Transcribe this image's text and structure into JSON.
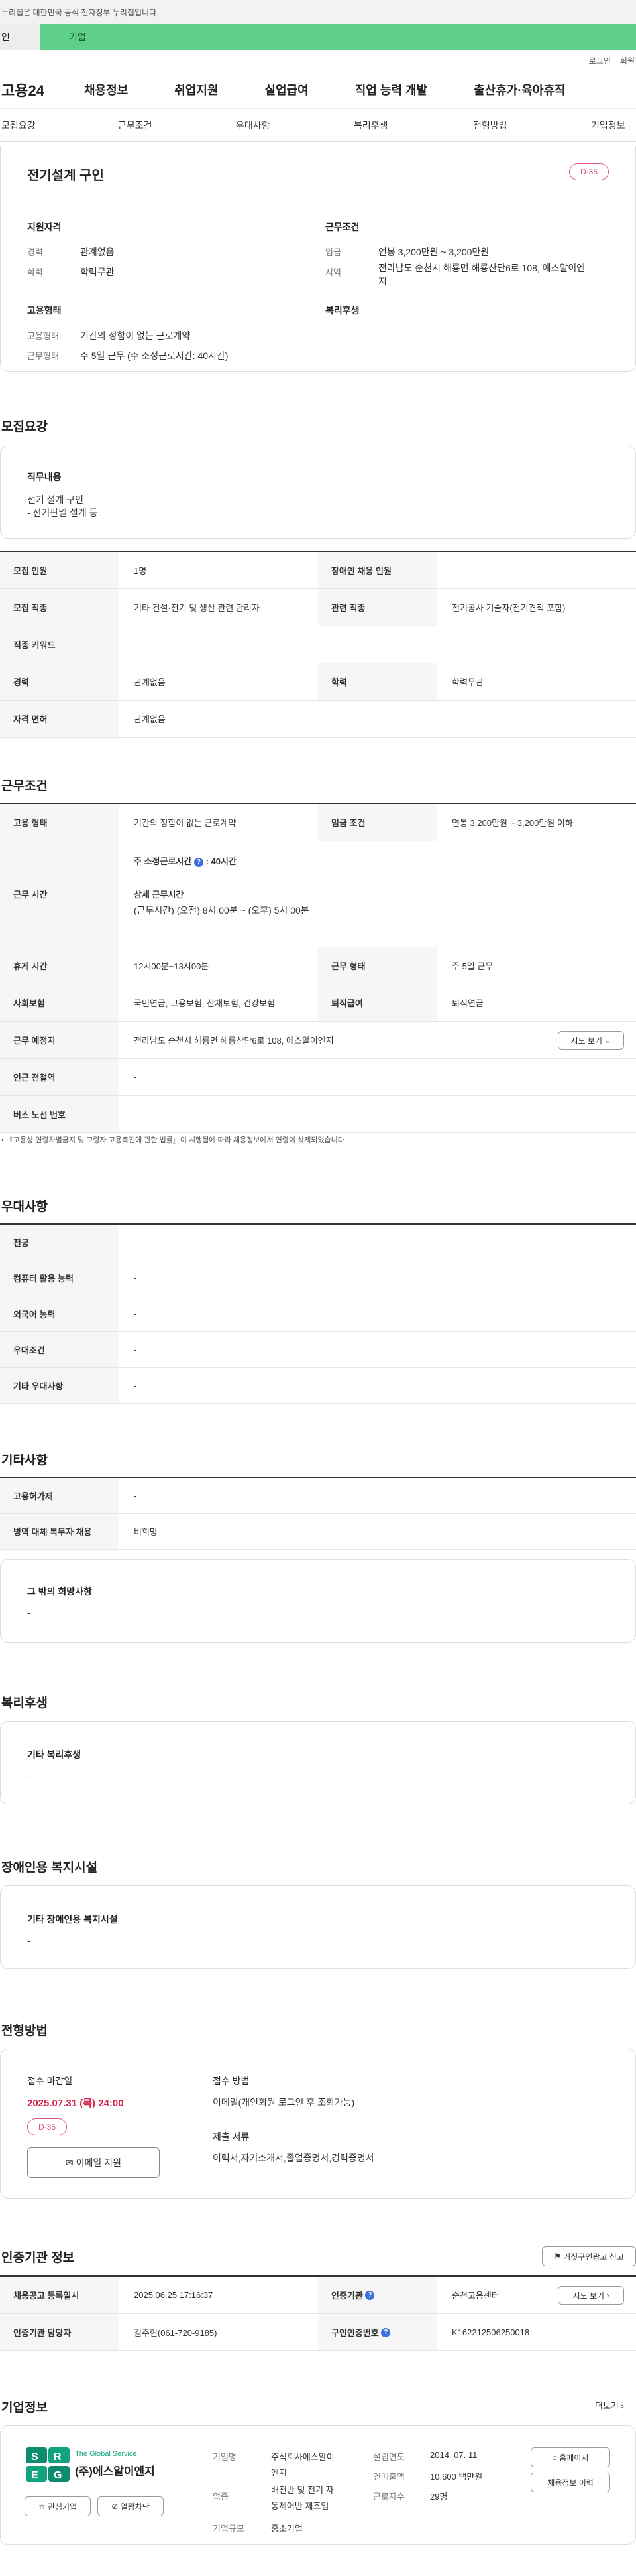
{
  "gov_banner": "이 누리집은 대한민국 공식 전자정부 누리집입니다.",
  "gov_banner_visible": "누리집은 대한민국 공식 전자정부 누리집입니다.",
  "top_tabs": [
    "개인",
    "기업"
  ],
  "top_tabs_visible": [
    "인",
    "기업"
  ],
  "util": {
    "login": "로그인",
    "join": "회원가입"
  },
  "util_visible": {
    "login": "로그인",
    "join": "회원"
  },
  "logo": "고용24",
  "gnb": [
    "채용정보",
    "취업지원",
    "실업급여",
    "직업 능력 개발",
    "출산휴가·육아휴직"
  ],
  "anchors": [
    "모집요강",
    "근무조건",
    "우대사항",
    "복리후생",
    "전형방법",
    "기업정보"
  ],
  "summary": {
    "title": "전기설계 구인",
    "dday": "D-35",
    "qual_h": "지원자격",
    "career_l": "경력",
    "career_v": "관계없음",
    "edu_l": "학력",
    "edu_v": "학력무관",
    "cond_h": "근무조건",
    "wage_l": "임금",
    "wage_v": "연봉 3,200만원 ~ 3,200만원",
    "area_l": "지역",
    "area_v1": "전라남도 순천시 해룡면 해룡산단6로 108, 에스알이엔",
    "area_v2": "지",
    "emp_h": "고용형태",
    "type_l": "고용형태",
    "type_v": "기간의 정함이 없는 근로계약",
    "form_l": "근무형태",
    "form_v": "주 5일 근무 (주 소정근로시간: 40시간)",
    "welfare_h": "복리후생"
  },
  "recruit": {
    "heading": "모집요강",
    "duty_h": "직무내용",
    "duty_1": "전기 설계 구인",
    "duty_2": "- 전기판넬 설계 등",
    "rows": [
      {
        "k1": "모집 인원",
        "v1": "1명",
        "k2": "장애인 채용 인원",
        "v2": "-"
      },
      {
        "k1": "모집 직종",
        "v1": "기타 건설·전기 및 생산 관련 관리자",
        "k2": "관련 직종",
        "v2": "전기공사 기술자(전기견적 포함)"
      },
      {
        "k1": "직종 키워드",
        "v1": "-"
      },
      {
        "k1": "경력",
        "v1": "관계없음",
        "k2": "학력",
        "v2": "학력무관"
      },
      {
        "k1": "자격 면허",
        "v1": "관계없음"
      }
    ]
  },
  "work": {
    "heading": "근무조건",
    "emp_k": "고용 형태",
    "emp_v": "기간의 정함이 없는 근로계약",
    "wage_k": "임금 조건",
    "wage_v": "연봉 3,200만원 ~ 3,200만원 이하",
    "time_k": "근무 시간",
    "time_a": "주 소정근로시간",
    "time_b": ": 40시간",
    "time_c": "상세 근무시간",
    "time_d": "(근무시간) (오전) 8시 00분 ~ (오후) 5시 00분",
    "rest_k": "휴게 시간",
    "rest_v": "12시00분~13시00분",
    "form_k": "근무 형태",
    "form_v": "주 5일 근무",
    "ins_k": "사회보험",
    "ins_v": "국민연금, 고용보험, 산재보험, 건강보험",
    "sev_k": "퇴직급여",
    "sev_v": "퇴직연금",
    "place_k": "근무 예정지",
    "place_v": "전라남도 순천시 해룡면 해룡산단6로 108, 에스알이엔지",
    "map_btn": "지도 보기",
    "sub_k": "인근 전철역",
    "sub_v": "-",
    "bus_k": "버스 노선 번호",
    "bus_v": "-",
    "note": "• 『고용상 연령차별금지 및 고령자 고용촉진에 관한 법률』이 시행됨에 따라 채용정보에서 연령이 삭제되었습니다."
  },
  "prefer": {
    "heading": "우대사항",
    "rows": [
      [
        "전공",
        "-"
      ],
      [
        "컴퓨터 활용 능력",
        "-"
      ],
      [
        "외국어 능력",
        "-"
      ],
      [
        "우대조건",
        "-"
      ],
      [
        "기타 우대사항",
        "-"
      ]
    ]
  },
  "etc": {
    "heading": "기타사항",
    "rows": [
      [
        "고용허가제",
        "-"
      ],
      [
        "병역 대체 복무자 채용",
        "비희망"
      ]
    ],
    "box_h": "그 밖의 희망사항",
    "box_v": "-"
  },
  "welfare": {
    "heading": "복리후생",
    "box_h": "기타 복리후생",
    "box_v": "-"
  },
  "disabled": {
    "heading": "장애인용 복지시설",
    "box_h": "기타 장애인용 복지시설",
    "box_v": "-"
  },
  "process": {
    "heading": "전형방법",
    "deadline_l": "접수 마감일",
    "deadline_v": "2025.07.31 (목) 24:00",
    "dday": "D-35",
    "email_btn": "이메일 지원",
    "method_l": "접수 방법",
    "method_v": "이메일(개인회원 로그인 후 조회가능)",
    "docs_l": "제출 서류",
    "docs_v": "이력서,자기소개서,졸업증명서,경력증명서"
  },
  "cert": {
    "heading": "인증기관 정보",
    "report_btn": "거짓구인광고 신고",
    "reg_k": "채용공고 등록일시",
    "reg_v": "2025.06.25 17:16:37",
    "org_k": "인증기관",
    "org_v": "순천고용센터",
    "map_btn": "지도 보기",
    "staff_k": "인증기관 담당자",
    "staff_v": "김주현(061-720-9185)",
    "no_k": "구인인증번호",
    "no_v": "K162212506250018"
  },
  "company": {
    "heading": "기업정보",
    "more": "더보기",
    "logo_small": "The Global Service",
    "logo_name": "(주)에스알이엔지",
    "interest_btn": "관심기업",
    "block_btn": "열람차단",
    "ind_l": "기업명",
    "ind_v1": "주식회사에스알이",
    "ind_v2": "엔지",
    "biz_l": "업종",
    "biz_v1": "배전반 및 전기 자",
    "biz_v2": "동제어반 제조업",
    "size_l": "기업규모",
    "size_v": "중소기업",
    "est_l": "설립연도",
    "est_v": "2014. 07. 11",
    "sales_l": "연매출액",
    "sales_v": "10,600 백만원",
    "emp_l": "근로자수",
    "emp_v": "29명",
    "home_btn": "홈페이지",
    "hist_btn": "채용정보 이력"
  },
  "colors": {
    "green": "#5fd08b",
    "pink": "#e0557a",
    "red": "#d6254d",
    "blue": "#3d6fe0"
  }
}
